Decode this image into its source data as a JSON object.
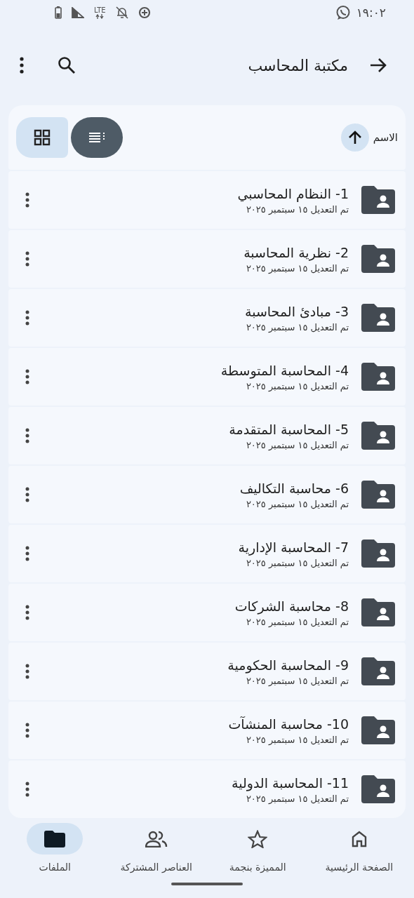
{
  "status_bar": {
    "time": "١٩:٠٢",
    "network": "LTE"
  },
  "header": {
    "title": "مكتبة المحاسب"
  },
  "sort": {
    "label": "الاسم",
    "ascending": true
  },
  "view_toggle": [
    {
      "kind": "list",
      "selected": true
    },
    {
      "kind": "grid",
      "selected": false
    }
  ],
  "files": [
    {
      "name": "1- النظام المحاسبي",
      "modified": "تم التعديل ١٥ سبتمبر ٢٠٢٥"
    },
    {
      "name": "2- نظرية المحاسبة",
      "modified": "تم التعديل ١٥ سبتمبر ٢٠٢٥"
    },
    {
      "name": "3- مبادئ المحاسبة",
      "modified": "تم التعديل ١٥ سبتمبر ٢٠٢٥"
    },
    {
      "name": "4- المحاسبة المتوسطة",
      "modified": "تم التعديل ١٥ سبتمبر ٢٠٢٥"
    },
    {
      "name": "5- المحاسبة المتقدمة",
      "modified": "تم التعديل ١٥ سبتمبر ٢٠٢٥"
    },
    {
      "name": "6- محاسبة التكاليف",
      "modified": "تم التعديل ١٥ سبتمبر ٢٠٢٥"
    },
    {
      "name": "7- المحاسبة الإدارية",
      "modified": "تم التعديل ١٥ سبتمبر ٢٠٢٥"
    },
    {
      "name": "8- محاسبة الشركات",
      "modified": "تم التعديل ١٥ سبتمبر ٢٠٢٥"
    },
    {
      "name": "9- المحاسبة الحكومية",
      "modified": "تم التعديل ١٥ سبتمبر ٢٠٢٥"
    },
    {
      "name": "10- محاسبة المنشآت",
      "modified": "تم التعديل ١٥ سبتمبر ٢٠٢٥"
    },
    {
      "name": "11- المحاسبة الدولية",
      "modified": "تم التعديل ١٥ سبتمبر ٢٠٢٥"
    }
  ],
  "nav": [
    {
      "kind": "home",
      "label": "الصفحة الرئيسية",
      "selected": false
    },
    {
      "kind": "starred",
      "label": "المميزة بنجمة",
      "selected": false
    },
    {
      "kind": "shared",
      "label": "العناصر المشتركة",
      "selected": false
    },
    {
      "kind": "files",
      "label": "الملفات",
      "selected": true
    }
  ]
}
